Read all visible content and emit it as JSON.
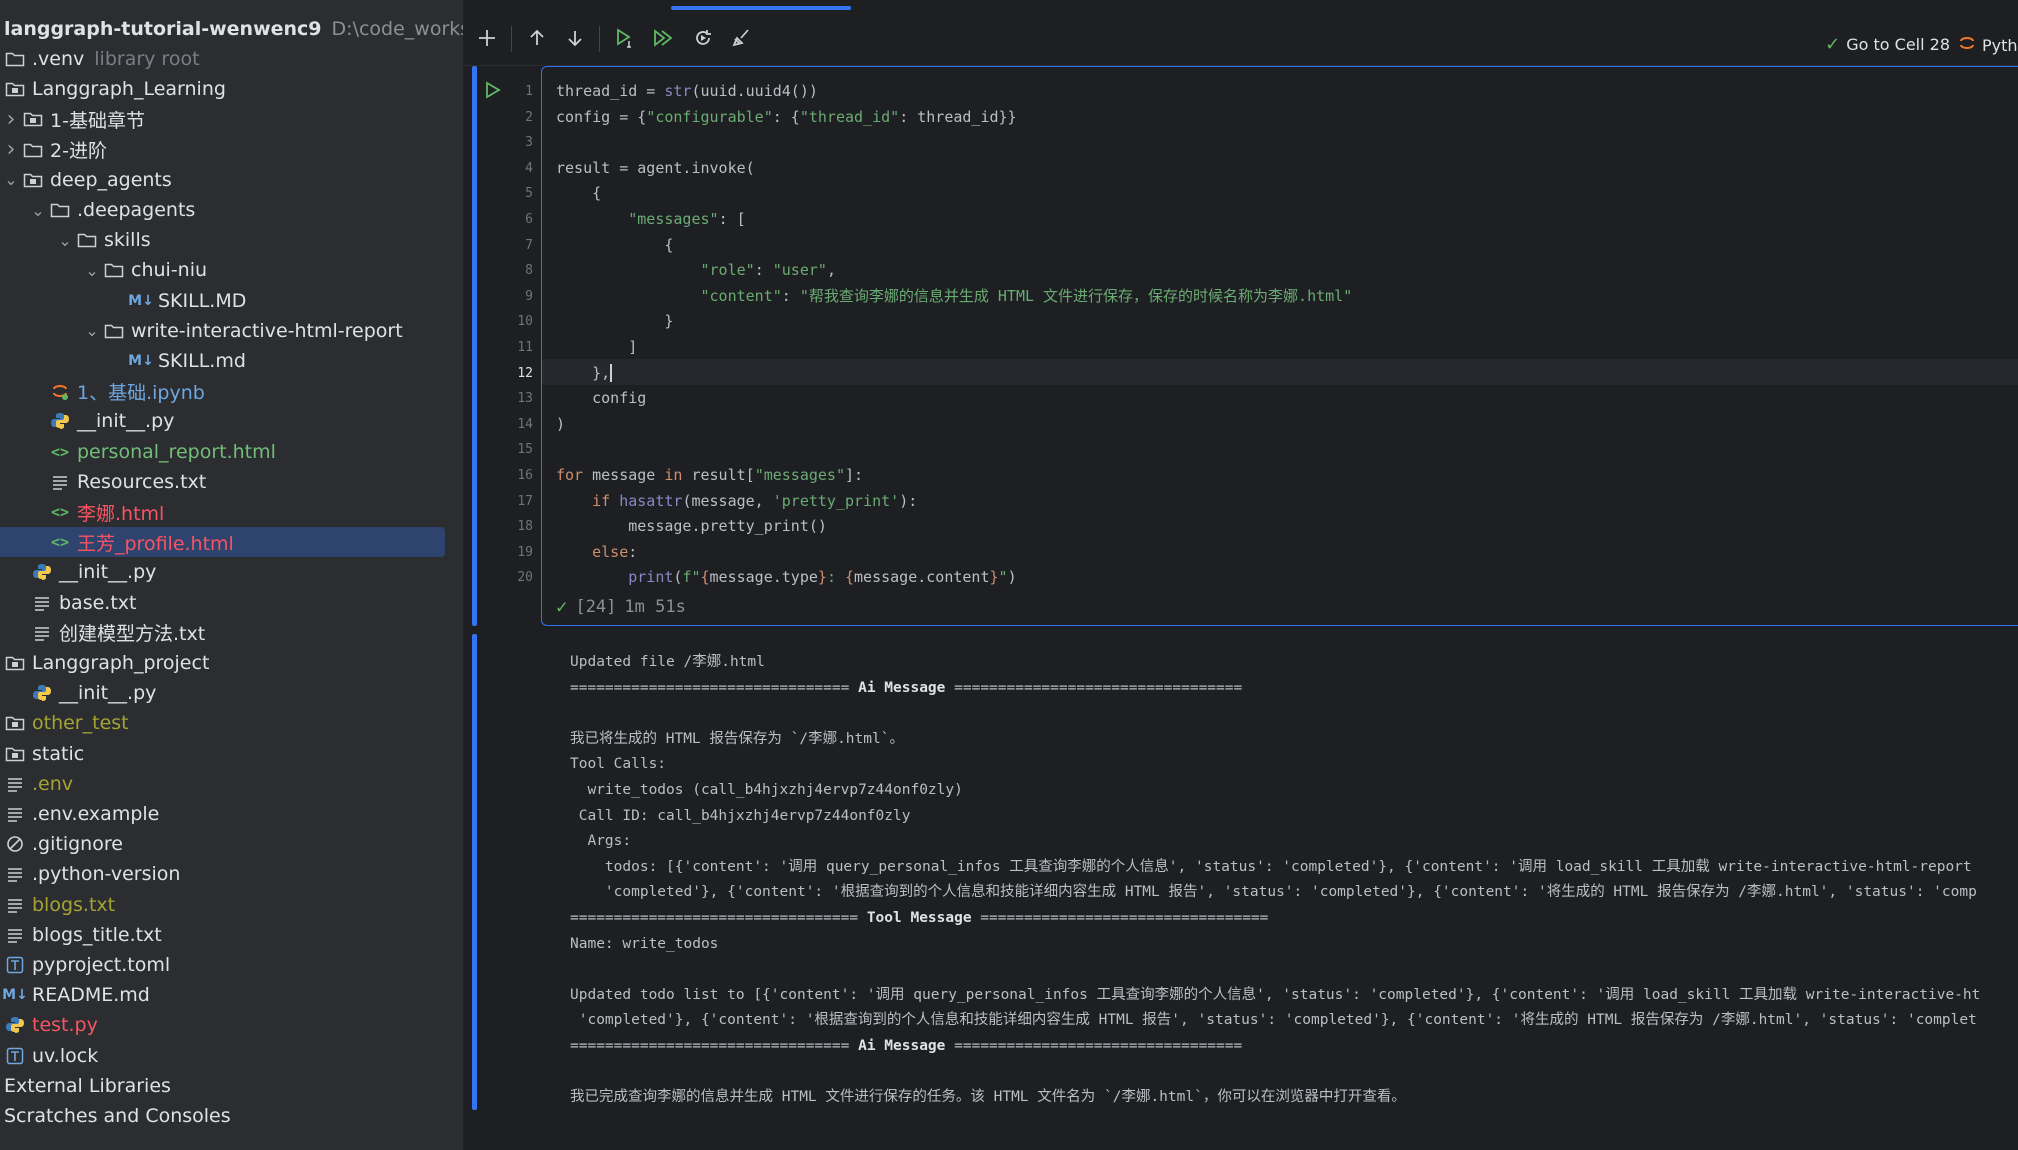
{
  "sidebar": {
    "header": {
      "name": "langgraph-tutorial-wenwenc9",
      "path": "D:\\code_works\\langg"
    },
    "items": [
      {
        "label": "venv",
        "sub": "library root",
        "depth": 0,
        "chev": "",
        "icon": "folder-icon",
        "color": ""
      },
      {
        "label": "Langgraph_Learning",
        "sub": "",
        "depth": 0,
        "chev": "",
        "icon": "module-folder-icon",
        "color": ""
      },
      {
        "label": "1-基础章节",
        "sub": "",
        "depth": 0,
        "chev": "›",
        "icon": "module-folder-icon",
        "color": ""
      },
      {
        "label": "2-进阶",
        "sub": "",
        "depth": 0,
        "chev": "›",
        "icon": "folder-icon",
        "color": ""
      },
      {
        "label": "deep_agents",
        "sub": "",
        "depth": 0,
        "chev": "⌄",
        "icon": "module-folder-icon",
        "color": ""
      },
      {
        "label": ".deepagents",
        "sub": "",
        "depth": 1,
        "chev": "⌄",
        "icon": "folder-icon",
        "color": ""
      },
      {
        "label": "skills",
        "sub": "",
        "depth": 2,
        "chev": "⌄",
        "icon": "folder-icon",
        "color": ""
      },
      {
        "label": "chui-niu",
        "sub": "",
        "depth": 3,
        "chev": "⌄",
        "icon": "folder-icon",
        "color": ""
      },
      {
        "label": "SKILL.MD",
        "sub": "",
        "depth": 4,
        "chev": "",
        "icon": "markdown-icon",
        "color": ""
      },
      {
        "label": "write-interactive-html-report",
        "sub": "",
        "depth": 3,
        "chev": "⌄",
        "icon": "folder-icon",
        "color": ""
      },
      {
        "label": "SKILL.md",
        "sub": "",
        "depth": 4,
        "chev": "",
        "icon": "markdown-icon",
        "color": ""
      },
      {
        "label": "1、基础.ipynb",
        "sub": "",
        "depth": 1,
        "chev": "",
        "icon": "jupyter-icon",
        "color": "blue"
      },
      {
        "label": "__init__.py",
        "sub": "",
        "depth": 1,
        "chev": "",
        "icon": "python-icon",
        "color": ""
      },
      {
        "label": "personal_report.html",
        "sub": "",
        "depth": 1,
        "chev": "",
        "icon": "html-icon",
        "color": "green"
      },
      {
        "label": "Resources.txt",
        "sub": "",
        "depth": 1,
        "chev": "",
        "icon": "text-file-icon",
        "color": ""
      },
      {
        "label": "李娜.html",
        "sub": "",
        "depth": 1,
        "chev": "",
        "icon": "html-icon",
        "color": "red"
      },
      {
        "label": "王芳_profile.html",
        "sub": "",
        "depth": 1,
        "chev": "",
        "icon": "html-icon",
        "color": "red",
        "selected": true
      },
      {
        "label": "__init__.py",
        "sub": "",
        "depth": 0,
        "chev": "",
        "icon": "python-icon",
        "color": "",
        "indent": 1
      },
      {
        "label": "base.txt",
        "sub": "",
        "depth": 0,
        "chev": "",
        "icon": "text-file-icon",
        "color": "",
        "indent": 1
      },
      {
        "label": "创建模型方法.txt",
        "sub": "",
        "depth": 0,
        "chev": "",
        "icon": "text-file-icon",
        "color": "",
        "indent": 1
      },
      {
        "label": "Langgraph_project",
        "sub": "",
        "depth": 0,
        "chev": "",
        "icon": "module-folder-icon",
        "color": ""
      },
      {
        "label": "__init__.py",
        "sub": "",
        "depth": 0,
        "chev": "",
        "icon": "python-icon",
        "color": "",
        "indent": 1
      },
      {
        "label": "other_test",
        "sub": "",
        "depth": 0,
        "chev": "",
        "icon": "module-folder-icon",
        "color": "yellow"
      },
      {
        "label": "static",
        "sub": "",
        "depth": 0,
        "chev": "",
        "icon": "module-folder-icon",
        "color": ""
      },
      {
        "label": ".env",
        "sub": "",
        "depth": 0,
        "chev": "",
        "icon": "text-file-icon",
        "color": "yellow"
      },
      {
        "label": ".env.example",
        "sub": "",
        "depth": 0,
        "chev": "",
        "icon": "text-file-icon",
        "color": ""
      },
      {
        "label": ".gitignore",
        "sub": "",
        "depth": 0,
        "chev": "",
        "icon": "ignore-icon",
        "color": ""
      },
      {
        "label": ".python-version",
        "sub": "",
        "depth": 0,
        "chev": "",
        "icon": "text-file-icon",
        "color": ""
      },
      {
        "label": "blogs.txt",
        "sub": "",
        "depth": 0,
        "chev": "",
        "icon": "text-file-icon",
        "color": "yellow"
      },
      {
        "label": "blogs_title.txt",
        "sub": "",
        "depth": 0,
        "chev": "",
        "icon": "text-file-icon",
        "color": ""
      },
      {
        "label": "pyproject.toml",
        "sub": "",
        "depth": 0,
        "chev": "",
        "icon": "toml-icon",
        "color": ""
      },
      {
        "label": "README.md",
        "sub": "",
        "depth": 0,
        "chev": "",
        "icon": "markdown-icon",
        "color": ""
      },
      {
        "label": "test.py",
        "sub": "",
        "depth": 0,
        "chev": "",
        "icon": "python-icon",
        "color": "red"
      },
      {
        "label": "uv.lock",
        "sub": "",
        "depth": 0,
        "chev": "",
        "icon": "toml-icon",
        "color": ""
      },
      {
        "label": "External Libraries",
        "sub": "",
        "depth": 0,
        "chev": "",
        "icon": "",
        "color": ""
      },
      {
        "label": "Scratches and Consoles",
        "sub": "",
        "depth": 0,
        "chev": "",
        "icon": "",
        "color": ""
      }
    ]
  },
  "toolbar": {
    "goto_cell": "Go to Cell 28",
    "kernel": "Pyth"
  },
  "cell": {
    "active_line": 12,
    "exec_count": "[24]",
    "exec_time": "1m 51s",
    "code": [
      [
        [
          "thread_id = ",
          ""
        ],
        [
          "str",
          "bi"
        ],
        [
          "(uuid.uuid4())",
          ""
        ]
      ],
      [
        [
          "config = {",
          ""
        ],
        [
          "\"configurable\"",
          "str"
        ],
        [
          ": {",
          ""
        ],
        [
          "\"thread_id\"",
          "str"
        ],
        [
          ": thread_id}}",
          ""
        ]
      ],
      [],
      [
        [
          "result = agent.invoke(",
          ""
        ]
      ],
      [
        [
          "    {",
          ""
        ]
      ],
      [
        [
          "        ",
          ""
        ],
        [
          "\"messages\"",
          "str"
        ],
        [
          ": [",
          ""
        ]
      ],
      [
        [
          "            {",
          ""
        ]
      ],
      [
        [
          "                ",
          ""
        ],
        [
          "\"role\"",
          "str"
        ],
        [
          ": ",
          ""
        ],
        [
          "\"user\"",
          "str"
        ],
        [
          ",",
          ""
        ]
      ],
      [
        [
          "                ",
          ""
        ],
        [
          "\"content\"",
          "str"
        ],
        [
          ": ",
          ""
        ],
        [
          "\"帮我查询李娜的信息并生成 HTML 文件进行保存，保存的时候名称为李娜.html\"",
          "str"
        ]
      ],
      [
        [
          "            }",
          ""
        ]
      ],
      [
        [
          "        ]",
          ""
        ]
      ],
      [
        [
          "    },",
          ""
        ],
        [
          "|",
          "cursor"
        ]
      ],
      [
        [
          "    config",
          ""
        ]
      ],
      [
        [
          ")",
          ""
        ]
      ],
      [],
      [
        [
          "for",
          "kw"
        ],
        [
          " message ",
          ""
        ],
        [
          "in",
          "kw"
        ],
        [
          " result[",
          ""
        ],
        [
          "\"messages\"",
          "str"
        ],
        [
          "]:",
          ""
        ]
      ],
      [
        [
          "    ",
          ""
        ],
        [
          "if",
          "kw"
        ],
        [
          " ",
          ""
        ],
        [
          "hasattr",
          "bi"
        ],
        [
          "(message, ",
          ""
        ],
        [
          "'pretty_print'",
          "str"
        ],
        [
          "):",
          ""
        ]
      ],
      [
        [
          "        message.pretty_print()",
          ""
        ]
      ],
      [
        [
          "    ",
          ""
        ],
        [
          "else",
          "kw"
        ],
        [
          ":",
          ""
        ]
      ],
      [
        [
          "        ",
          ""
        ],
        [
          "print",
          "bi"
        ],
        [
          "(",
          ""
        ],
        [
          "f\"",
          "str"
        ],
        [
          "{",
          "fstr-br"
        ],
        [
          "message.type",
          ""
        ],
        [
          "}",
          "fstr-br"
        ],
        [
          ": ",
          "str"
        ],
        [
          "{",
          "fstr-br"
        ],
        [
          "message.content",
          ""
        ],
        [
          "}",
          "fstr-br"
        ],
        [
          "\"",
          "str"
        ],
        [
          ")",
          ""
        ]
      ]
    ]
  },
  "output": [
    "Updated file /李娜.html",
    "================================ **Ai Message** =================================",
    "",
    "我已将生成的 HTML 报告保存为 `/李娜.html`。",
    "Tool Calls:",
    "  write_todos (call_b4hjxzhj4ervp7z44onf0zly)",
    " Call ID: call_b4hjxzhj4ervp7z44onf0zly",
    "  Args:",
    "    todos: [{'content': '调用 query_personal_infos 工具查询李娜的个人信息', 'status': 'completed'}, {'content': '调用 load_skill 工具加载 write-interactive-html-report",
    "    'completed'}, {'content': '根据查询到的个人信息和技能详细内容生成 HTML 报告', 'status': 'completed'}, {'content': '将生成的 HTML 报告保存为 /李娜.html', 'status': 'comp",
    "================================= **Tool Message** =================================",
    "Name: write_todos",
    "",
    "Updated todo list to [{'content': '调用 query_personal_infos 工具查询李娜的个人信息', 'status': 'completed'}, {'content': '调用 load_skill 工具加载 write-interactive-ht",
    " 'completed'}, {'content': '根据查询到的个人信息和技能详细内容生成 HTML 报告', 'status': 'completed'}, {'content': '将生成的 HTML 报告保存为 /李娜.html', 'status': 'complet",
    "================================ **Ai Message** =================================",
    "",
    "我已完成查询李娜的信息并生成 HTML 文件进行保存的任务。该 HTML 文件名为 `/李娜.html`，你可以在浏览器中打开查看。"
  ]
}
